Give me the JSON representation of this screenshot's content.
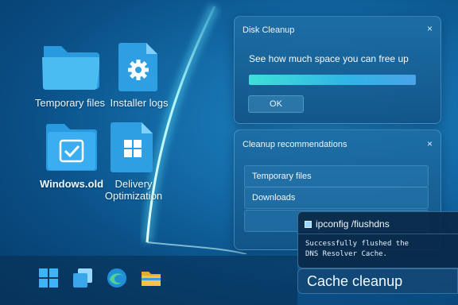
{
  "desktop": {
    "icons": [
      {
        "label": "Temporary files",
        "icon": "folder-icon"
      },
      {
        "label": "Installer logs",
        "icon": "settings-file-icon"
      },
      {
        "label": "Windows.old",
        "icon": "check-folder-icon"
      },
      {
        "label": "Delivery\nOptimization",
        "icon": "windows-file-icon"
      }
    ]
  },
  "disk_cleanup": {
    "title": "Disk Cleanup",
    "close": "×",
    "heading": "See how much space you can free up",
    "progress_fraction": 1.0,
    "ok_label": "OK"
  },
  "recommendations": {
    "title": "Cleanup recommendations",
    "close": "×",
    "items": [
      "Temporary  files",
      "Downloads",
      ""
    ]
  },
  "terminal": {
    "command": "ipconfig /fiushdns",
    "output_line1": "Successfully flushed the",
    "output_line2": "DNS Resolver Cache."
  },
  "cache_label": "Cache cleanup",
  "taskbar": {
    "apps": [
      "windows-start-icon",
      "task-view-icon",
      "edge-browser-icon",
      "file-explorer-icon"
    ]
  },
  "colors": {
    "accent": "#2fb4e6",
    "progress_start": "#3ee0d8",
    "background": "#136aa6"
  }
}
